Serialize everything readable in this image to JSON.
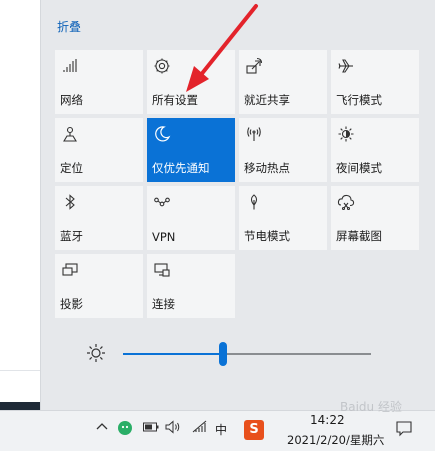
{
  "panel": {
    "collapse_label": "折叠",
    "tiles": [
      {
        "label": "网络",
        "icon": "network-icon",
        "active": false
      },
      {
        "label": "所有设置",
        "icon": "gear-icon",
        "active": false
      },
      {
        "label": "就近共享",
        "icon": "nearby-share-icon",
        "active": false
      },
      {
        "label": "飞行模式",
        "icon": "airplane-icon",
        "active": false
      },
      {
        "label": "定位",
        "icon": "location-icon",
        "active": false
      },
      {
        "label": "仅优先通知",
        "icon": "moon-icon",
        "active": true
      },
      {
        "label": "移动热点",
        "icon": "hotspot-icon",
        "active": false
      },
      {
        "label": "夜间模式",
        "icon": "night-light-icon",
        "active": false
      },
      {
        "label": "蓝牙",
        "icon": "bluetooth-icon",
        "active": false
      },
      {
        "label": "VPN",
        "icon": "vpn-icon",
        "active": false
      },
      {
        "label": "节电模式",
        "icon": "battery-saver-icon",
        "active": false
      },
      {
        "label": "屏幕截图",
        "icon": "screen-snip-icon",
        "active": false
      },
      {
        "label": "投影",
        "icon": "project-icon",
        "active": false
      },
      {
        "label": "连接",
        "icon": "connect-icon",
        "active": false
      }
    ],
    "brightness": {
      "level": 0.4,
      "icon": "brightness-sun-icon"
    }
  },
  "taskbar": {
    "ime_label": "中",
    "sogou_label": "S",
    "time": "14:22",
    "date": "2021/2/20/星期六"
  },
  "watermark": "Baidu 经验",
  "colors": {
    "accent": "#0a72d6",
    "tile": "#f4f5f6",
    "panel": "#e6e8eb",
    "annotation_arrow": "#e3232b"
  }
}
